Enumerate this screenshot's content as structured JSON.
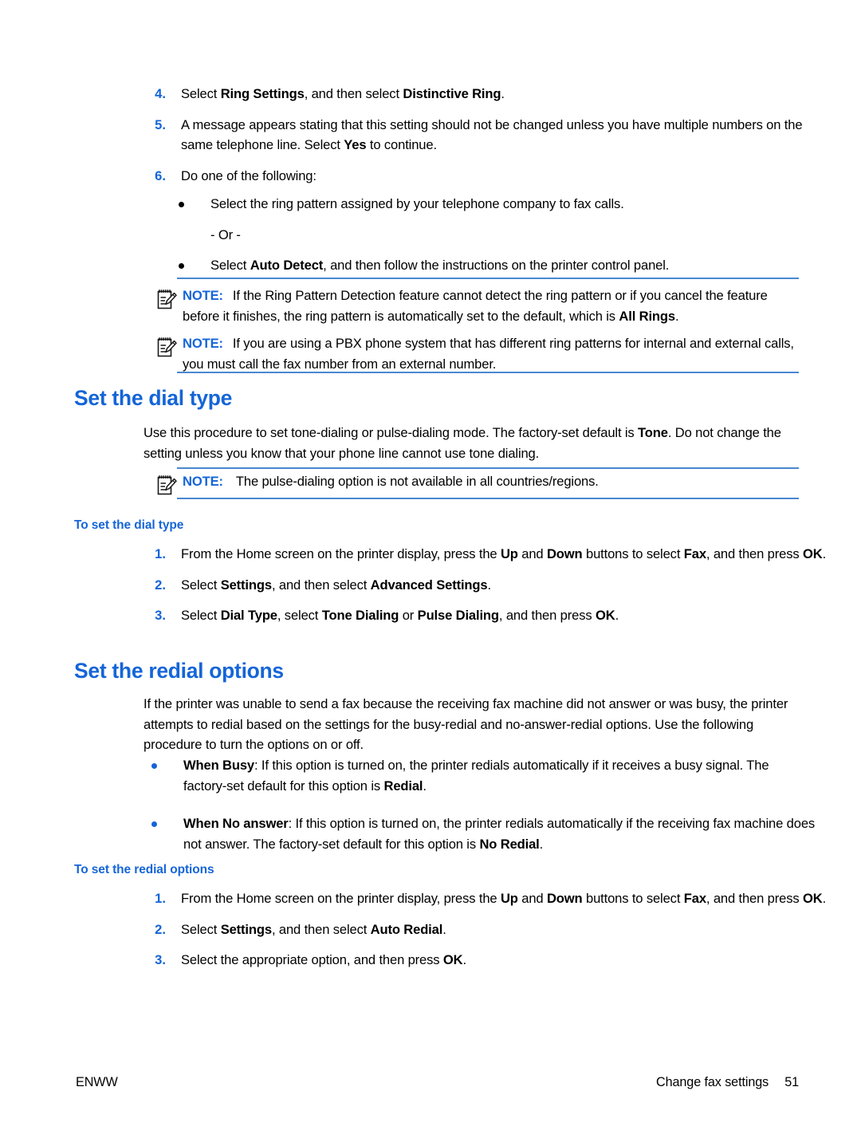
{
  "page": {
    "number": "51",
    "footer_left": "ENWW",
    "footer_right": "Change fax settings"
  },
  "steps_continued": [
    {
      "num": "4.",
      "parts": [
        {
          "t": "Select ",
          "b": false
        },
        {
          "t": "Ring Settings",
          "b": true
        },
        {
          "t": ", and then select ",
          "b": false
        },
        {
          "t": "Distinctive Ring",
          "b": true
        },
        {
          "t": ".",
          "b": false
        }
      ]
    },
    {
      "num": "5.",
      "parts": [
        {
          "t": "A message appears stating that this setting should not be changed unless you have multiple numbers on the same telephone line. Select ",
          "b": false
        },
        {
          "t": "Yes",
          "b": true
        },
        {
          "t": " to continue.",
          "b": false
        }
      ]
    },
    {
      "num": "6.",
      "parts": [
        {
          "t": "Do one of the following:",
          "b": false
        }
      ]
    }
  ],
  "do_one_of": {
    "first_bullet": [
      {
        "t": "Select the ring pattern assigned by your telephone company to fax calls.",
        "b": false
      }
    ],
    "or_text": "- Or -",
    "second_bullet": [
      {
        "t": "Select ",
        "b": false
      },
      {
        "t": "Auto Detect",
        "b": true
      },
      {
        "t": ", and then follow the instructions on the printer control panel.",
        "b": false
      }
    ]
  },
  "notes": [
    {
      "label": "NOTE:",
      "parts": [
        {
          "t": "If the Ring Pattern Detection feature cannot detect the ring pattern or if you cancel the feature before it finishes, the ring pattern is automatically set to the default, which is ",
          "b": false
        },
        {
          "t": "All Rings",
          "b": true
        },
        {
          "t": ".",
          "b": false
        }
      ]
    },
    {
      "label": "NOTE:",
      "parts": [
        {
          "t": "If you are using a PBX phone system that has different ring patterns for internal and external calls, you must call the fax number from an external number.",
          "b": false
        }
      ]
    },
    {
      "label": "NOTE:",
      "parts": [
        {
          "t": "The pulse-dialing option is not available in all countries/regions.",
          "b": false
        }
      ]
    }
  ],
  "section_dial_type": {
    "heading": "Set the dial type",
    "intro": [
      {
        "t": "Use this procedure to set tone-dialing or pulse-dialing mode. The factory-set default is ",
        "b": false
      },
      {
        "t": "Tone",
        "b": true
      },
      {
        "t": ". Do not change the setting unless you know that your phone line cannot use tone dialing.",
        "b": false
      }
    ],
    "subheading": "To set the dial type",
    "steps": [
      {
        "num": "1.",
        "parts": [
          {
            "t": "From the Home screen on the printer display, press the ",
            "b": false
          },
          {
            "t": "Up",
            "b": true
          },
          {
            "t": " and ",
            "b": false
          },
          {
            "t": "Down",
            "b": true
          },
          {
            "t": " buttons to select ",
            "b": false
          },
          {
            "t": "Fax",
            "b": true
          },
          {
            "t": ", and then press ",
            "b": false
          },
          {
            "t": "OK",
            "b": true
          },
          {
            "t": ".",
            "b": false
          }
        ]
      },
      {
        "num": "2.",
        "parts": [
          {
            "t": "Select ",
            "b": false
          },
          {
            "t": "Settings",
            "b": true
          },
          {
            "t": ", and then select ",
            "b": false
          },
          {
            "t": "Advanced Settings",
            "b": true
          },
          {
            "t": ".",
            "b": false
          }
        ]
      },
      {
        "num": "3.",
        "parts": [
          {
            "t": "Select ",
            "b": false
          },
          {
            "t": "Dial Type",
            "b": true
          },
          {
            "t": ", select ",
            "b": false
          },
          {
            "t": "Tone Dialing",
            "b": true
          },
          {
            "t": " or ",
            "b": false
          },
          {
            "t": "Pulse Dialing",
            "b": true
          },
          {
            "t": ", and then press ",
            "b": false
          },
          {
            "t": "OK",
            "b": true
          },
          {
            "t": ".",
            "b": false
          }
        ]
      }
    ]
  },
  "section_redial": {
    "heading": "Set the redial options",
    "intro": [
      {
        "t": "If the printer was unable to send a fax because the receiving fax machine did not answer or was busy, the printer attempts to redial based on the settings for the busy-redial and no-answer-redial options. Use the following procedure to turn the options on or off.",
        "b": false
      }
    ],
    "bullets": [
      [
        {
          "t": "When Busy",
          "b": true
        },
        {
          "t": ": If this option is turned on, the printer redials automatically if it receives a busy signal. The factory-set default for this option is ",
          "b": false
        },
        {
          "t": "Redial",
          "b": true
        },
        {
          "t": ".",
          "b": false
        }
      ],
      [
        {
          "t": "When No answer",
          "b": true
        },
        {
          "t": ": If this option is turned on, the printer redials automatically if the receiving fax machine does not answer. The factory-set default for this option is ",
          "b": false
        },
        {
          "t": "No Redial",
          "b": true
        },
        {
          "t": ".",
          "b": false
        }
      ]
    ],
    "subheading": "To set the redial options",
    "steps": [
      {
        "num": "1.",
        "parts": [
          {
            "t": "From the Home screen on the printer display, press the ",
            "b": false
          },
          {
            "t": "Up",
            "b": true
          },
          {
            "t": " and ",
            "b": false
          },
          {
            "t": "Down",
            "b": true
          },
          {
            "t": " buttons to select ",
            "b": false
          },
          {
            "t": "Fax",
            "b": true
          },
          {
            "t": ", and then press ",
            "b": false
          },
          {
            "t": "OK",
            "b": true
          },
          {
            "t": ".",
            "b": false
          }
        ]
      },
      {
        "num": "2.",
        "parts": [
          {
            "t": "Select ",
            "b": false
          },
          {
            "t": "Settings",
            "b": true
          },
          {
            "t": ", and then select ",
            "b": false
          },
          {
            "t": "Auto Redial",
            "b": true
          },
          {
            "t": ".",
            "b": false
          }
        ]
      },
      {
        "num": "3.",
        "parts": [
          {
            "t": "Select the appropriate option, and then press ",
            "b": false
          },
          {
            "t": "OK",
            "b": true
          },
          {
            "t": ".",
            "b": false
          }
        ]
      }
    ]
  },
  "colors": {
    "accent_blue": "#1565d8",
    "rule_blue": "#4a87d1",
    "text_black": "#000000",
    "background": "#ffffff"
  }
}
